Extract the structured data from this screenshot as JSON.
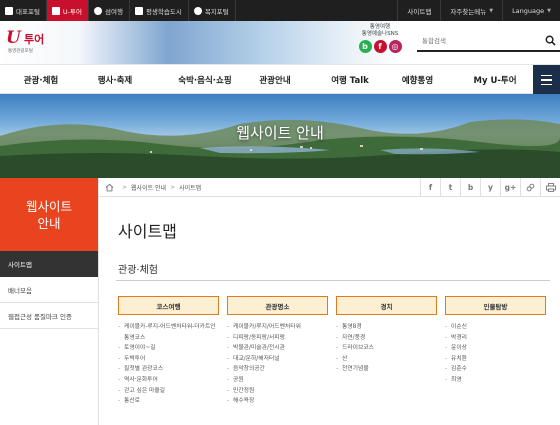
{
  "topbar": {
    "left": [
      {
        "label": "대표포털",
        "active": false,
        "icon": "portal-icon"
      },
      {
        "label": "U-투어",
        "active": true,
        "icon": "utour-icon"
      },
      {
        "label": "섬여행",
        "active": false,
        "icon": "island-icon"
      },
      {
        "label": "평생학습도시",
        "active": false,
        "icon": "learning-icon"
      },
      {
        "label": "복지포털",
        "active": false,
        "icon": "heart-icon"
      }
    ],
    "right": [
      {
        "label": "사이트맵"
      },
      {
        "label": "자주찾는메뉴"
      },
      {
        "label": "Language"
      }
    ]
  },
  "header": {
    "logo_mark": "U",
    "logo_text": "투어",
    "logo_sub": "통영관광포털",
    "sns_title_1": "통영여행",
    "sns_title_2": "통영예술나SNS",
    "sns_buttons": [
      "b",
      "f",
      "◎"
    ],
    "search_placeholder": "통합검색"
  },
  "nav": {
    "items": [
      "관광·체험",
      "행사·축제",
      "숙박·음식·쇼핑",
      "관광안내",
      "여행 Talk",
      "예향통영",
      "My U-투어"
    ]
  },
  "banner": {
    "title": "웹사이트 안내"
  },
  "sidebar": {
    "title_1": "웹사이트",
    "title_2": "안내",
    "items": [
      {
        "label": "사이트맵",
        "active": true
      },
      {
        "label": "배너모음",
        "active": false
      },
      {
        "label": "웹접근성 품질마크 인증",
        "active": false
      }
    ]
  },
  "breadcrumb": {
    "items": [
      "웹사이트 안내",
      "사이트맵"
    ]
  },
  "share": [
    "f",
    "t",
    "b",
    "y",
    "g+",
    "link",
    "print"
  ],
  "content": {
    "page_title": "사이트맵",
    "section_title": "관광·체험",
    "columns": [
      {
        "header": "코스여행",
        "items": [
          "케이블카-루지-어드벤처타워-더카트인통영코스",
          "토영이야~길",
          "두벅투어",
          "필첫별 관광코스",
          "역사·문화투어",
          "걷고 싶은 마을길",
          "통산로"
        ]
      },
      {
        "header": "관광명소",
        "items": [
          "케이블카/루지/어드벤처타워",
          "디피랑/동피랑/서피랑",
          "박물관/미술관/전시관",
          "대교/운하/해저터널",
          "음악창의공간",
          "공원",
          "민간정원",
          "해수욕장"
        ]
      },
      {
        "header": "경치",
        "items": [
          "통영8경",
          "자연/풍경",
          "드라이브코스",
          "산",
          "천연기념물"
        ]
      },
      {
        "header": "인물탐방",
        "items": [
          "이순신",
          "박경리",
          "윤이상",
          "유치환",
          "김춘수",
          "최영"
        ]
      }
    ]
  },
  "colors": {
    "topbar_bg": "#1f1f1f",
    "accent_red": "#c8102e",
    "sidebar_orange": "#e8441f",
    "menu_navy": "#1c2f4a",
    "column_border": "#e07a1f",
    "column_fill": "#fcefd2"
  }
}
